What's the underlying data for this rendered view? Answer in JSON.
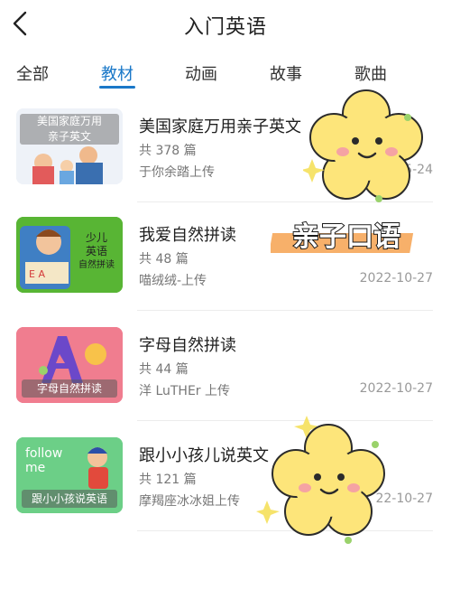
{
  "header": {
    "title": "入门英语",
    "back_icon": "chevron-left-icon"
  },
  "tabs": [
    {
      "label": "全部",
      "active": false
    },
    {
      "label": "教材",
      "active": true
    },
    {
      "label": "动画",
      "active": false
    },
    {
      "label": "故事",
      "active": false
    },
    {
      "label": "歌曲",
      "active": false
    }
  ],
  "items": [
    {
      "title": "美国家庭万用亲子英文",
      "count": "共 378 篇",
      "uploader": "于你余踏上传",
      "date": "05-24",
      "thumb_caption_1": "美国家庭万用",
      "thumb_caption_2": "亲子英文"
    },
    {
      "title": "我爱自然拼读",
      "count": "共 48 篇",
      "uploader": "喵绒绒-上传",
      "date": "2022-10-27",
      "thumb_text_1": "少儿",
      "thumb_text_2": "英语",
      "thumb_text_3": "自然拼读"
    },
    {
      "title": "字母自然拼读",
      "count": "共 44 篇",
      "uploader": "洋 LuTHEr 上传",
      "date": "2022-10-27",
      "thumb_caption": "字母自然拼读"
    },
    {
      "title": "跟小小孩儿说英文",
      "count": "共 121 篇",
      "uploader": "摩羯座冰冰姐上传",
      "date": "22-10-27",
      "thumb_text": "follow me",
      "thumb_caption": "跟小小孩说英语"
    }
  ],
  "sticker": {
    "text": "亲子口语"
  },
  "colors": {
    "accent": "#1a78c8",
    "flower": "#fde57a",
    "flower_outline": "#2b2b2b"
  }
}
